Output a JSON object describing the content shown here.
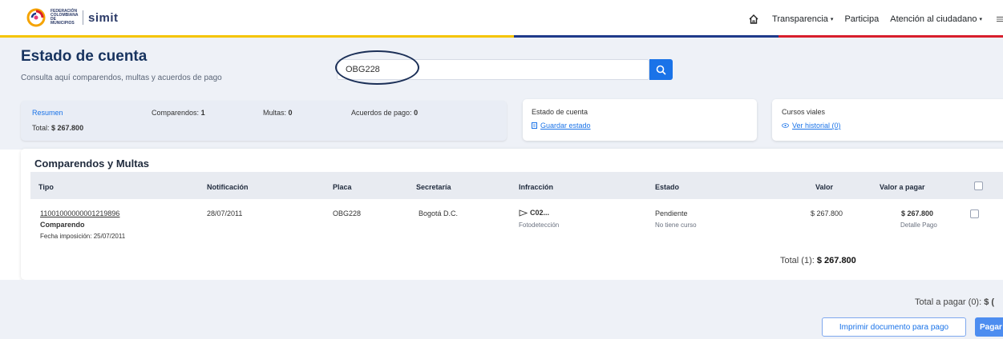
{
  "brand": {
    "federation_text": "FEDERACIÓN COLOMBIANA DE MUNICIPIOS",
    "app_name": "simit"
  },
  "nav": {
    "home_icon": "home-icon",
    "items": [
      {
        "label": "Transparencia",
        "dropdown": true
      },
      {
        "label": "Participa",
        "dropdown": false
      },
      {
        "label": "Atención al ciudadano",
        "dropdown": true
      }
    ],
    "menu_icon": "hamburger-menu-icon",
    "caret": "▾"
  },
  "colors": {
    "yellow": "#f5c400",
    "blue": "#1f3a8a",
    "red": "#d81e2c",
    "accent": "#1a73e8",
    "title": "#17335f"
  },
  "header": {
    "title": "Estado de cuenta",
    "subtitle": "Consulta aquí comparendos, multas y acuerdos de pago",
    "search_value": "OBG228",
    "search_icon": "search-icon"
  },
  "summary": {
    "resumen_label": "Resumen",
    "total_label": "Total:",
    "total_value": "$ 267.800",
    "comparendos_label": "Comparendos:",
    "comparendos_value": "1",
    "multas_label": "Multas:",
    "multas_value": "0",
    "acuerdos_label": "Acuerdos de pago:",
    "acuerdos_value": "0"
  },
  "estado_card": {
    "title": "Estado de cuenta",
    "link": "Guardar estado"
  },
  "cursos_card": {
    "title": "Cursos viales",
    "link": "Ver historial (0)"
  },
  "table": {
    "section_title": "Comparendos y Multas",
    "headers": [
      "Tipo",
      "Notificación",
      "Placa",
      "Secretaría",
      "Infracción",
      "Estado",
      "Valor",
      "Valor a pagar"
    ],
    "rows": [
      {
        "number": "11001000000001219896",
        "type": "Comparendo",
        "fecha_imposicion": "Fecha imposición: 25/07/2011",
        "notificacion": "28/07/2011",
        "placa": "OBG228",
        "secretaria": "Bogotá D.C.",
        "infraccion_code": "C02...",
        "infraccion_desc": "Fotodetección",
        "estado": "Pendiente",
        "estado_sub": "No tiene curso",
        "valor": "$ 267.800",
        "valor_pagar": "$ 267.800",
        "detalle": "Detalle Pago"
      }
    ],
    "total_label": "Total (1):",
    "total_value": "$ 267.800"
  },
  "footer": {
    "total_pagar": "Total a pagar (0):",
    "total_pagar_value": "$ (",
    "print_button": "Imprimir documento para pago",
    "pay_button": "Pagar"
  }
}
